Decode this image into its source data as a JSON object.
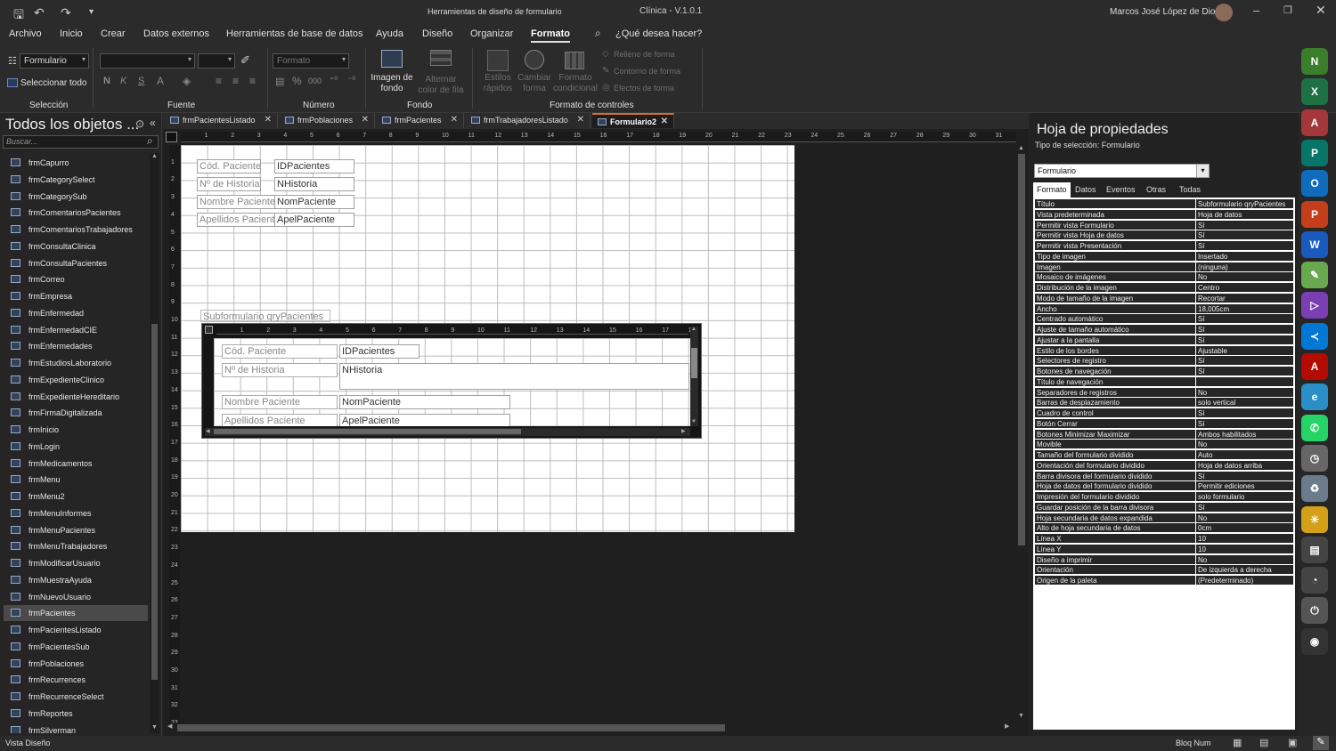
{
  "titlebar": {
    "context_title": "Herramientas de diseño de formulario",
    "app_title": "Clínica - V.1.0.1",
    "user_name": "Marcos José López de Dios"
  },
  "menu": [
    {
      "label": "Archivo"
    },
    {
      "label": "Inicio"
    },
    {
      "label": "Crear"
    },
    {
      "label": "Datos externos"
    },
    {
      "label": "Herramientas de base de datos"
    },
    {
      "label": "Ayuda"
    },
    {
      "label": "Diseño"
    },
    {
      "label": "Organizar"
    },
    {
      "label": "Formato"
    }
  ],
  "tell_me": "¿Qué desea hacer?",
  "ribbon": {
    "selection_combo": "Formulario",
    "select_all": "Seleccionar todo",
    "group_seleccion": "Selección",
    "group_fuente": "Fuente",
    "group_numero": "Número",
    "number_format": "Formato",
    "group_fondo": "Fondo",
    "group_formato_controles": "Formato de controles",
    "imagen_fondo": "Imagen de fondo",
    "alternar_color": "Alternar color de fila",
    "estilos_rapidos": "Estilos rápidos",
    "cambiar_forma": "Cambiar forma",
    "formato_condicional": "Formato condicional",
    "relleno_forma": "Relleno de forma",
    "contorno_forma": "Contorno de forma",
    "efectos_forma": "Efectos de forma"
  },
  "nav": {
    "title": "Todos los objetos ...",
    "search_placeholder": "Buscar...",
    "items": [
      {
        "label": "frmCapurro"
      },
      {
        "label": "frmCategorySelect"
      },
      {
        "label": "frmCategorySub"
      },
      {
        "label": "frmComentariosPacientes"
      },
      {
        "label": "frmComentariosTrabajadores"
      },
      {
        "label": "frmConsultaClinica"
      },
      {
        "label": "frmConsultaPacientes"
      },
      {
        "label": "frmCorreo"
      },
      {
        "label": "frmEmpresa"
      },
      {
        "label": "frmEnfermedad"
      },
      {
        "label": "frmEnfermedadCIE"
      },
      {
        "label": "frmEnfermedades"
      },
      {
        "label": "frmEstudiosLaboratorio"
      },
      {
        "label": "frmExpedienteClinico"
      },
      {
        "label": "frmExpedienteHereditario"
      },
      {
        "label": "frmFirmaDigitalizada"
      },
      {
        "label": "frmInicio"
      },
      {
        "label": "frmLogin"
      },
      {
        "label": "frmMedicamentos"
      },
      {
        "label": "frmMenu"
      },
      {
        "label": "frmMenu2"
      },
      {
        "label": "frmMenuInformes"
      },
      {
        "label": "frmMenuPacientes"
      },
      {
        "label": "frmMenuTrabajadores"
      },
      {
        "label": "frmModificarUsuario"
      },
      {
        "label": "frmMuestraAyuda"
      },
      {
        "label": "frmNuevoUsuario"
      },
      {
        "label": "frmPacientes"
      },
      {
        "label": "frmPacientesListado"
      },
      {
        "label": "frmPacientesSub"
      },
      {
        "label": "frmPoblaciones"
      },
      {
        "label": "frmRecurrences"
      },
      {
        "label": "frmRecurrenceSelect"
      },
      {
        "label": "frmReportes"
      },
      {
        "label": "frmSilverman"
      }
    ],
    "selected": "frmPacientes"
  },
  "tabs": [
    {
      "label": "frmPacientesListado"
    },
    {
      "label": "frmPoblaciones"
    },
    {
      "label": "frmPacientes"
    },
    {
      "label": "frmTrabajadoresListado"
    },
    {
      "label": "Formulario2"
    }
  ],
  "form": {
    "controls": [
      {
        "label": "Cód. Paciente",
        "field": "IDPacientes"
      },
      {
        "label": "Nº de Historia",
        "field": "NHistoria"
      },
      {
        "label": "Nombre Paciente",
        "field": "NomPaciente"
      },
      {
        "label": "Apellidos Paciente",
        "field": "ApelPaciente"
      }
    ],
    "subform_label": "Subformulario qryPacientes",
    "sub_controls": [
      {
        "label": "Cód. Paciente",
        "field": "IDPacientes"
      },
      {
        "label": "Nº de Historia",
        "field": "NHistoria"
      },
      {
        "label": "Nombre Paciente",
        "field": "NomPaciente"
      },
      {
        "label": "Apellidos Paciente",
        "field": "ApelPaciente"
      }
    ]
  },
  "properties": {
    "title": "Hoja de propiedades",
    "selection_type_label": "Tipo de selección:",
    "selection_type": "Formulario",
    "combo_value": "Formulario",
    "tabs": [
      "Formato",
      "Datos",
      "Eventos",
      "Otras",
      "Todas"
    ],
    "rows": [
      {
        "name": "Título",
        "value": "Subformulario qryPacientes"
      },
      {
        "name": "Vista predeterminada",
        "value": "Hoja de datos"
      },
      {
        "name": "Permitir vista Formulario",
        "value": "Sí"
      },
      {
        "name": "Permitir vista Hoja de datos",
        "value": "Sí"
      },
      {
        "name": "Permitir vista Presentación",
        "value": "Sí"
      },
      {
        "name": "Tipo de imagen",
        "value": "Insertado"
      },
      {
        "name": "Imagen",
        "value": "(ninguna)"
      },
      {
        "name": "Mosaico de imágenes",
        "value": "No"
      },
      {
        "name": "Distribución de la imagen",
        "value": "Centro"
      },
      {
        "name": "Modo de tamaño de la imagen",
        "value": "Recortar"
      },
      {
        "name": "Ancho",
        "value": "18,005cm"
      },
      {
        "name": "Centrado automático",
        "value": "Sí"
      },
      {
        "name": "Ajuste de tamaño automático",
        "value": "Sí"
      },
      {
        "name": "Ajustar a la pantalla",
        "value": "Sí"
      },
      {
        "name": "Estilo de los bordes",
        "value": "Ajustable"
      },
      {
        "name": "Selectores de registro",
        "value": "Sí"
      },
      {
        "name": "Botones de navegación",
        "value": "Sí"
      },
      {
        "name": "Título de navegación",
        "value": ""
      },
      {
        "name": "Separadores de registros",
        "value": "No"
      },
      {
        "name": "Barras de desplazamiento",
        "value": "solo vertical"
      },
      {
        "name": "Cuadro de control",
        "value": "Sí"
      },
      {
        "name": "Botón Cerrar",
        "value": "Sí"
      },
      {
        "name": "Botones Minimizar Maximizar",
        "value": "Ambos habilitados"
      },
      {
        "name": "Movible",
        "value": "No"
      },
      {
        "name": "Tamaño del formulario dividido",
        "value": "Auto"
      },
      {
        "name": "Orientación del formulario dividido",
        "value": "Hoja de datos arriba"
      },
      {
        "name": "Barra divisora del formulario dividido",
        "value": "Sí"
      },
      {
        "name": "Hoja de datos del formulario dividido",
        "value": "Permitir ediciones"
      },
      {
        "name": "Impresión del formulario dividido",
        "value": "solo formulario"
      },
      {
        "name": "Guardar posición de la barra divisora",
        "value": "Sí"
      },
      {
        "name": "Hoja secundaria de datos expandida",
        "value": "No"
      },
      {
        "name": "Alto de hoja secundaria de datos",
        "value": "0cm"
      },
      {
        "name": "Línea X",
        "value": "10"
      },
      {
        "name": "Línea Y",
        "value": "10"
      },
      {
        "name": "Diseño a imprimir",
        "value": "No"
      },
      {
        "name": "Orientación",
        "value": "De izquierda a derecha"
      },
      {
        "name": "Origen de la paleta",
        "value": "(Predeterminado)"
      }
    ]
  },
  "status": {
    "view": "Vista Diseño",
    "numlock": "Bloq Num"
  },
  "dock_icons": [
    {
      "name": "nexus-icon",
      "color": "#3a7d2a",
      "glyph": "N"
    },
    {
      "name": "excel-icon",
      "color": "#1e7145",
      "glyph": "X"
    },
    {
      "name": "access-icon",
      "color": "#a4373a",
      "glyph": "A"
    },
    {
      "name": "publisher-icon",
      "color": "#077568",
      "glyph": "P"
    },
    {
      "name": "outlook-icon",
      "color": "#0f6cbd",
      "glyph": "O"
    },
    {
      "name": "powerpoint-icon",
      "color": "#c43e1c",
      "glyph": "P"
    },
    {
      "name": "word-icon",
      "color": "#185abd",
      "glyph": "W"
    },
    {
      "name": "notepad-icon",
      "color": "#6aa84f",
      "glyph": "✎"
    },
    {
      "name": "visual-studio-icon",
      "color": "#7b3fb3",
      "glyph": "▷"
    },
    {
      "name": "vscode-icon",
      "color": "#0078d4",
      "glyph": "≺"
    },
    {
      "name": "acrobat-icon",
      "color": "#b30b00",
      "glyph": "A"
    },
    {
      "name": "edge-icon",
      "color": "#2a8fc7",
      "glyph": "e"
    },
    {
      "name": "whatsapp-icon",
      "color": "#25d366",
      "glyph": "✆"
    },
    {
      "name": "clock-icon",
      "color": "#666666",
      "glyph": "◷"
    },
    {
      "name": "recycle-bin-icon",
      "color": "#6b7b8c",
      "glyph": "♻"
    },
    {
      "name": "weather-icon",
      "color": "#d4a017",
      "glyph": "☀"
    },
    {
      "name": "disk-meter-icon",
      "color": "#444444",
      "glyph": "▤"
    },
    {
      "name": "cpu-meter-icon",
      "color": "#444444",
      "glyph": "◔"
    },
    {
      "name": "power-icon",
      "color": "#555555",
      "glyph": "⏻"
    },
    {
      "name": "camera-icon",
      "color": "#333333",
      "glyph": "◉"
    }
  ]
}
